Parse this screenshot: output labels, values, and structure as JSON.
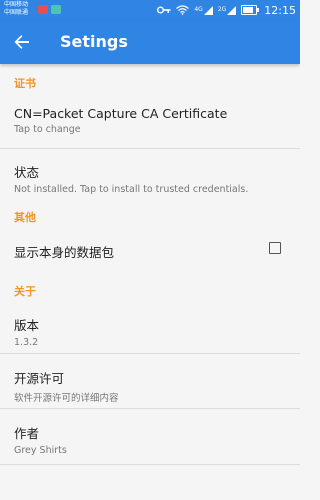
{
  "status_bar": {
    "carrier_1": "中国移动",
    "carrier_2": "中国联通",
    "time": "12:15",
    "network_4g": "4G",
    "network_2g": "2G",
    "battery_level": 0.8,
    "icons": [
      "key-icon",
      "wifi-icon",
      "signal-icon",
      "battery-icon"
    ]
  },
  "app_bar": {
    "title": "Setings",
    "back_icon": "arrow-back-icon",
    "color": "#2f84e4"
  },
  "sections": {
    "certificate": {
      "header": "证书",
      "cert_title": "CN=Packet Capture CA Certificate",
      "cert_summary": "Tap to change",
      "status_title": "状态",
      "status_summary": "Not installed. Tap to install to trusted credentials."
    },
    "other": {
      "header": "其他",
      "show_own_packets_title": "显示本身的数据包",
      "show_own_packets_checked": false
    },
    "about": {
      "header": "关于",
      "version_title": "版本",
      "version_value": "1.3.2",
      "license_title": "开源许可",
      "license_summary": "软件开源许可的详细内容",
      "author_title": "作者",
      "author_value": "Grey Shirts"
    }
  },
  "colors": {
    "accent": "#f4951f",
    "primary": "#2f84e4",
    "background": "#f5f5f5"
  }
}
